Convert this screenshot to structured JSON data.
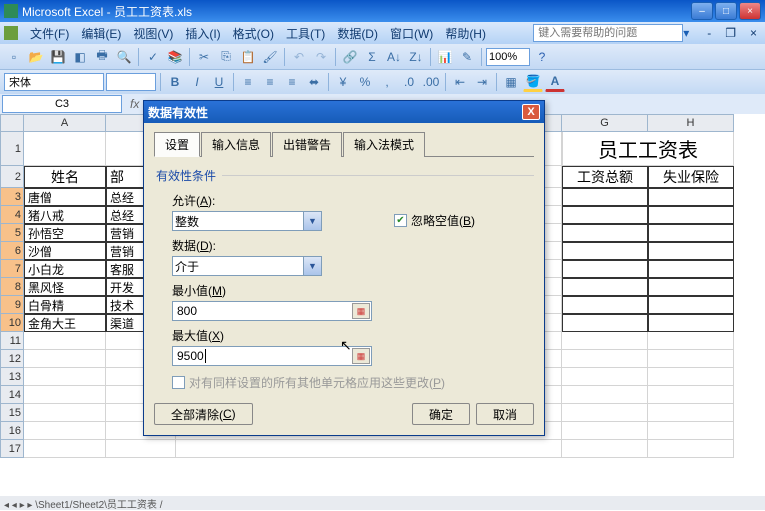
{
  "title": "Microsoft Excel - 员工工资表.xls",
  "menu": {
    "file": "文件(F)",
    "edit": "编辑(E)",
    "view": "视图(V)",
    "insert": "插入(I)",
    "format": "格式(O)",
    "tools": "工具(T)",
    "data": "数据(D)",
    "window": "窗口(W)",
    "help": "帮助(H)"
  },
  "help_placeholder": "键入需要帮助的问题",
  "zoom": "100%",
  "font_name": "宋体",
  "namebox": "C3",
  "columns": {
    "A": "A",
    "B": "部",
    "G": "G",
    "H": "H"
  },
  "sheet_title_gh": "员工工资表",
  "headers": {
    "name": "姓名",
    "dept": "部",
    "total": "工资总额",
    "ins": "失业保险"
  },
  "rows": [
    {
      "n": "3",
      "name": "唐僧",
      "dept": "总经"
    },
    {
      "n": "4",
      "name": "猪八戒",
      "dept": "总经"
    },
    {
      "n": "5",
      "name": "孙悟空",
      "dept": "营销"
    },
    {
      "n": "6",
      "name": "沙僧",
      "dept": "营销"
    },
    {
      "n": "7",
      "name": "小白龙",
      "dept": "客服"
    },
    {
      "n": "8",
      "name": "黑风怪",
      "dept": "开发"
    },
    {
      "n": "9",
      "name": "白骨精",
      "dept": "技术"
    },
    {
      "n": "10",
      "name": "金角大王",
      "dept": "渠道"
    }
  ],
  "sheettabs": "◂ ◂ ▸ ▸ \\Sheet1/Sheet2\\员工工资表 /",
  "dialog": {
    "title": "数据有效性",
    "tabs": {
      "settings": "设置",
      "input": "输入信息",
      "error": "出错警告",
      "ime": "输入法模式"
    },
    "fs_label": "有效性条件",
    "allow_label": "允许(A):",
    "allow_value": "整数",
    "ignore_blank": "忽略空值(B)",
    "data_label": "数据(D):",
    "data_value": "介于",
    "min_label": "最小值(M)",
    "min_value": "800",
    "max_label": "最大值(X)",
    "max_value": "9500",
    "apply_all": "对有同样设置的所有其他单元格应用这些更改(P)",
    "clear": "全部清除(C)",
    "ok": "确定",
    "cancel": "取消"
  }
}
